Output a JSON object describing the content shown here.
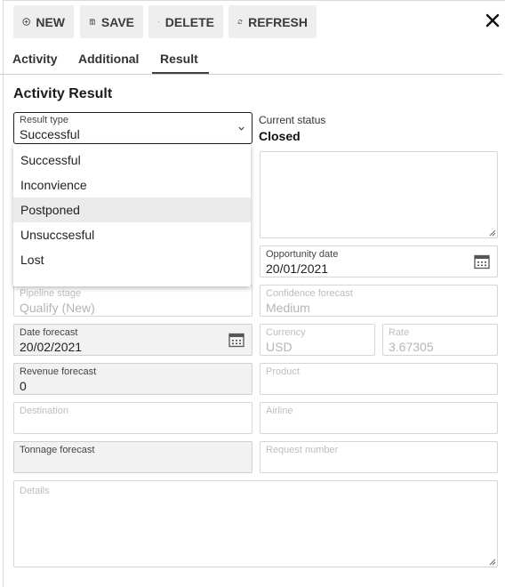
{
  "toolbar": {
    "new_label": "NEW",
    "save_label": "SAVE",
    "delete_label": "DELETE",
    "refresh_label": "REFRESH",
    "close_icon": "close-icon"
  },
  "tabs": [
    {
      "label": "Activity"
    },
    {
      "label": "Additional"
    },
    {
      "label": "Result",
      "active": true
    }
  ],
  "section_title": "Activity Result",
  "result_type": {
    "label": "Result type",
    "value": "Successful",
    "options": [
      "Successful",
      "Inconvience",
      "Postponed",
      "Unsuccsesful",
      "Lost"
    ],
    "highlighted": "Postponed"
  },
  "current_status": {
    "label": "Current status",
    "value": "Closed"
  },
  "fields": {
    "opportunity_date": {
      "label": "Opportunity date",
      "value": "20/01/2021"
    },
    "pipeline_stage": {
      "label": "Pipeline stage",
      "value": "Qualify (New)"
    },
    "confidence_forecast": {
      "label": "Confidence forecast",
      "value": "Medium"
    },
    "date_forecast": {
      "label": "Date forecast",
      "value": "20/02/2021"
    },
    "currency": {
      "label": "Currency",
      "value": "USD"
    },
    "rate": {
      "label": "Rate",
      "value": "3.67305"
    },
    "revenue_forecast": {
      "label": "Revenue forecast",
      "value": "0"
    },
    "product": {
      "label": "Product",
      "value": ""
    },
    "destination": {
      "label": "Destination",
      "value": ""
    },
    "airline": {
      "label": "Airline",
      "value": ""
    },
    "tonnage_forecast": {
      "label": "Tonnage forecast",
      "value": ""
    },
    "request_number": {
      "label": "Request number",
      "value": ""
    },
    "details": {
      "label": "Details",
      "value": ""
    }
  },
  "colors": {
    "accent": "#424242",
    "toolbar_bg": "#eeeeee",
    "highlight": "#ebebeb"
  }
}
